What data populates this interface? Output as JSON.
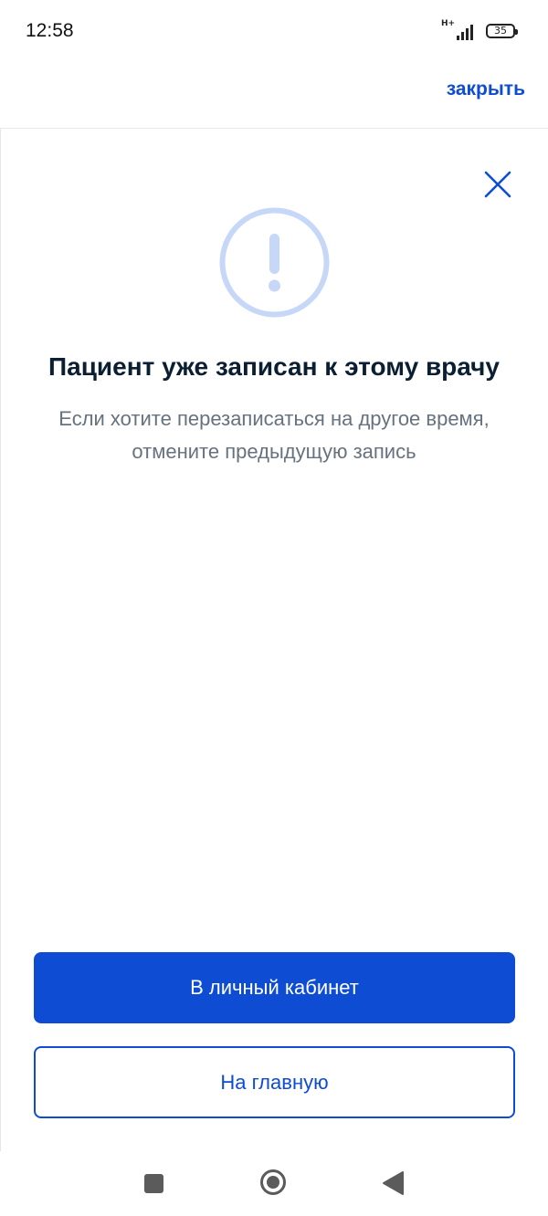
{
  "status_bar": {
    "time": "12:58",
    "network": "H+",
    "battery": "35"
  },
  "top_bar": {
    "close_label": "закрыть"
  },
  "dialog": {
    "icon": "exclamation-circle-icon",
    "title": "Пациент уже записан к этому врачу",
    "message_line1": "Если хотите перезаписаться на другое время,",
    "message_line2": "отмените предыдущую запись"
  },
  "actions": {
    "primary_label": "В личный кабинет",
    "secondary_label": "На главную"
  },
  "colors": {
    "accent": "#0d4cd3",
    "icon_ring": "#c7d7f7",
    "title": "#0b1f33",
    "subtitle": "#66727f"
  }
}
